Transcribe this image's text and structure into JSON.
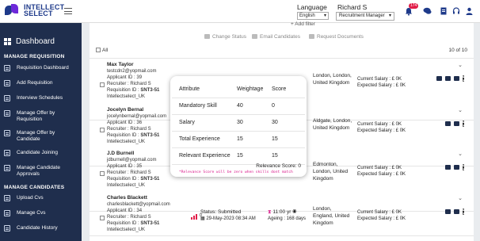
{
  "header": {
    "logo_line1": "INTELLECT",
    "logo_line2": "SELECT",
    "language_label": "Language",
    "language_value": "English",
    "user_name": "Richard S",
    "role_value": "Recruitment Manager",
    "notification_count": "174"
  },
  "sidebar": {
    "dashboard_label": "Dashboard",
    "sections": [
      {
        "title": "MANAGE REQUISITION",
        "items": [
          "Requisition Dashboard",
          "Add Requisition",
          "Interview Schedules",
          "Manage Offer by Requisition",
          "Manage Offer by Candidate",
          "Candidate Joining",
          "Manage Candidate Approvals"
        ]
      },
      {
        "title": "MANAGE CANDIDATES",
        "items": [
          "Upload Cvs",
          "Manage Cvs",
          "Candidate History"
        ]
      }
    ]
  },
  "toolbar": {
    "add_filter": "Add filter",
    "change_status": "Change Status",
    "email_candidates": "Email Candidates",
    "request_documents": "Request Documents",
    "all_label": "All",
    "count_label": "10 of 10"
  },
  "candidates": [
    {
      "name": "Max Taylor",
      "email": "testcdn2@yopmail.com",
      "applicant_id": "Applicant ID : 39",
      "recruiter": "Recruiter : Richard S",
      "requisition": "Requisition ID :",
      "requisition_id": "SNT3-51",
      "company": "Intellectselect_UK",
      "location": "London, London, United Kingdom",
      "current_salary": "Current Salary : £ 0K",
      "expected_salary": "Expected Salary : £ 0K"
    },
    {
      "name": "Jocelyn Bernal",
      "email": "jocelynbernal@yopmail.com",
      "applicant_id": "Applicant ID : 36",
      "recruiter": "Recruiter : Richard S",
      "requisition": "Requisition ID :",
      "requisition_id": "SNT3-51",
      "company": "Intellectselect_UK",
      "location": "Aldgate, London, United Kingdom",
      "current_salary": "Current Salary : £ 0K",
      "expected_salary": "Expected Salary : £ 0K"
    },
    {
      "name": "J.D Burnell",
      "email": "jdburnell@yopmail.com",
      "applicant_id": "Applicant ID : 35",
      "recruiter": "Recruiter : Richard S",
      "requisition": "Requisition ID :",
      "requisition_id": "SNT3-51",
      "company": "Intellectselect_UK",
      "location": "Edmonton, London, United Kingdom",
      "current_salary": "Current Salary : £ 0K",
      "expected_salary": "Expected Salary : £ 0K"
    },
    {
      "name": "Charles Blackett",
      "email": "charlesblackett@yopmail.com",
      "applicant_id": "Applicant ID : 34",
      "recruiter": "Recruiter : Richard S",
      "requisition": "Requisition ID :",
      "requisition_id": "SNT3-51",
      "company": "Intellectselect_UK",
      "location": "London, England, United Kingdom",
      "current_salary": "Current Salary : £ 0K",
      "expected_salary": "Expected Salary : £ 0K",
      "status": "Status: Submitted",
      "status_date": "29-May-2023 08:34 AM",
      "time": "11:00 yr",
      "ageing": "Ageing : 168 days",
      "score_icon": "0"
    }
  ],
  "modal": {
    "headers": [
      "Attribute",
      "Weightage",
      "Score"
    ],
    "rows": [
      {
        "attribute": "Mandatory Skill",
        "weightage": "40",
        "score": "0"
      },
      {
        "attribute": "Salary",
        "weightage": "30",
        "score": "30"
      },
      {
        "attribute": "Total Experience",
        "weightage": "15",
        "score": "15"
      },
      {
        "attribute": "Relevant Experience",
        "weightage": "15",
        "score": "15"
      }
    ],
    "relevance_score": "Relevance Score: 0",
    "note": "*Relevance Score will be zero when skills dont match"
  },
  "colors": {
    "sidebar_bg": "#1f2e4d",
    "accent": "#1e3a8a",
    "note": "#d9178a",
    "badge": "#e11d48"
  }
}
